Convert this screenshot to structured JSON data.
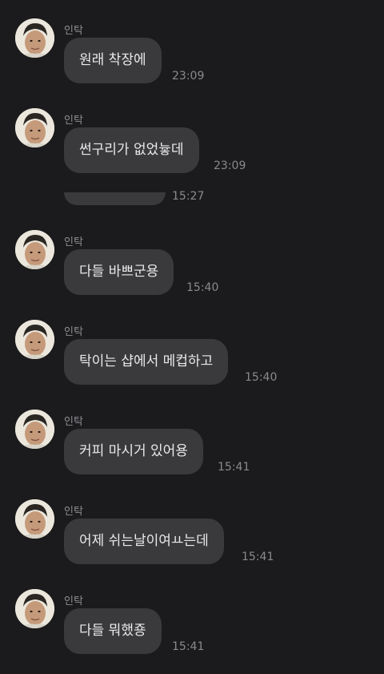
{
  "chat": {
    "messages": [
      {
        "sender": "인탁",
        "text": "원래 착장에",
        "time": "23:09",
        "avatar_icon": "profile-photo-avatar"
      },
      {
        "sender": "인탁",
        "text": "썬구리가 없었늏데",
        "time": "23:09",
        "avatar_icon": "profile-photo-avatar"
      },
      {
        "sender": "",
        "text": "",
        "time": "15:27",
        "avatar_icon": ""
      },
      {
        "sender": "인탁",
        "text": "다들 바쁘군용",
        "time": "15:40",
        "avatar_icon": "profile-photo-avatar"
      },
      {
        "sender": "인탁",
        "text": "탁이는 샵에서 메컵하고",
        "time": "15:40",
        "avatar_icon": "profile-photo-avatar"
      },
      {
        "sender": "인탁",
        "text": "커피 마시거 있어용",
        "time": "15:41",
        "avatar_icon": "profile-photo-avatar"
      },
      {
        "sender": "인탁",
        "text": "어제 쉬는날이여ㅛ는데",
        "time": "15:41",
        "avatar_icon": "profile-photo-avatar"
      },
      {
        "sender": "인탁",
        "text": "다들 뭐했죵",
        "time": "15:41",
        "avatar_icon": "profile-photo-avatar"
      }
    ]
  },
  "colors": {
    "background": "#1b1b1d",
    "bubble": "#3a3a3d",
    "bubble_text": "#e9e9eb",
    "meta_text": "#8a8a8e"
  }
}
